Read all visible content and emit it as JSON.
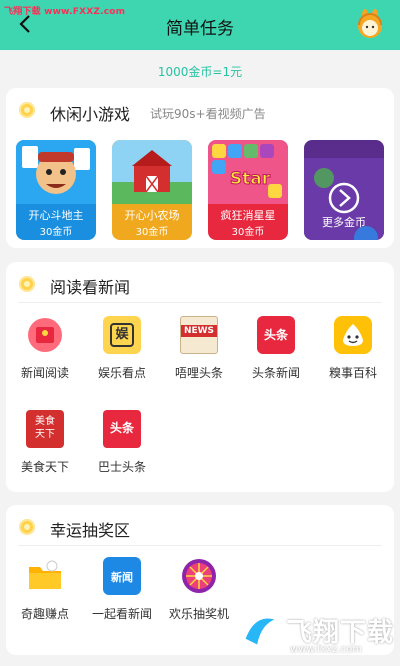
{
  "watermark_top": "飞翔下载 www.FXXZ.com",
  "header": {
    "title": "简单任务"
  },
  "rate_text": "1000金币=1元",
  "games_section": {
    "title": "休闲小游戏",
    "subtitle": "试玩90s+看视频广告",
    "items": [
      {
        "name": "开心斗地主",
        "coins": "30金币",
        "color": "#1a8fe0"
      },
      {
        "name": "开心小农场",
        "coins": "30金币",
        "color": "#f0a81e"
      },
      {
        "name": "疯狂消星星",
        "coins": "30金币",
        "color": "#e8283f"
      },
      {
        "name": "更多金币",
        "coins": "",
        "color": "#7a3fb8"
      }
    ],
    "star_text": "Star"
  },
  "news_section": {
    "title": "阅读看新闻",
    "items": [
      {
        "label": "新闻阅读",
        "icon": "red-envelope-icon"
      },
      {
        "label": "娱乐看点",
        "icon": "entertainment-icon",
        "glyph": "娱"
      },
      {
        "label": "唔哩头条",
        "icon": "news-paper-icon",
        "glyph": "NEWS"
      },
      {
        "label": "头条新闻",
        "icon": "toutiao-icon",
        "glyph": "头条"
      },
      {
        "label": "糗事百科",
        "icon": "qiushi-icon"
      },
      {
        "label": "美食天下",
        "icon": "food-icon",
        "glyph": "美食天下"
      },
      {
        "label": "巴士头条",
        "icon": "bus-news-icon",
        "glyph": "头条"
      }
    ]
  },
  "lottery_section": {
    "title": "幸运抽奖区",
    "items": [
      {
        "label": "奇趣赚点",
        "icon": "folder-icon"
      },
      {
        "label": "一起看新闻",
        "icon": "news-together-icon",
        "glyph": "新闻"
      },
      {
        "label": "欢乐抽奖机",
        "icon": "lottery-wheel-icon"
      }
    ]
  },
  "watermark_bottom": {
    "text": "飞翔下载",
    "url": "www.fxxz.com"
  }
}
